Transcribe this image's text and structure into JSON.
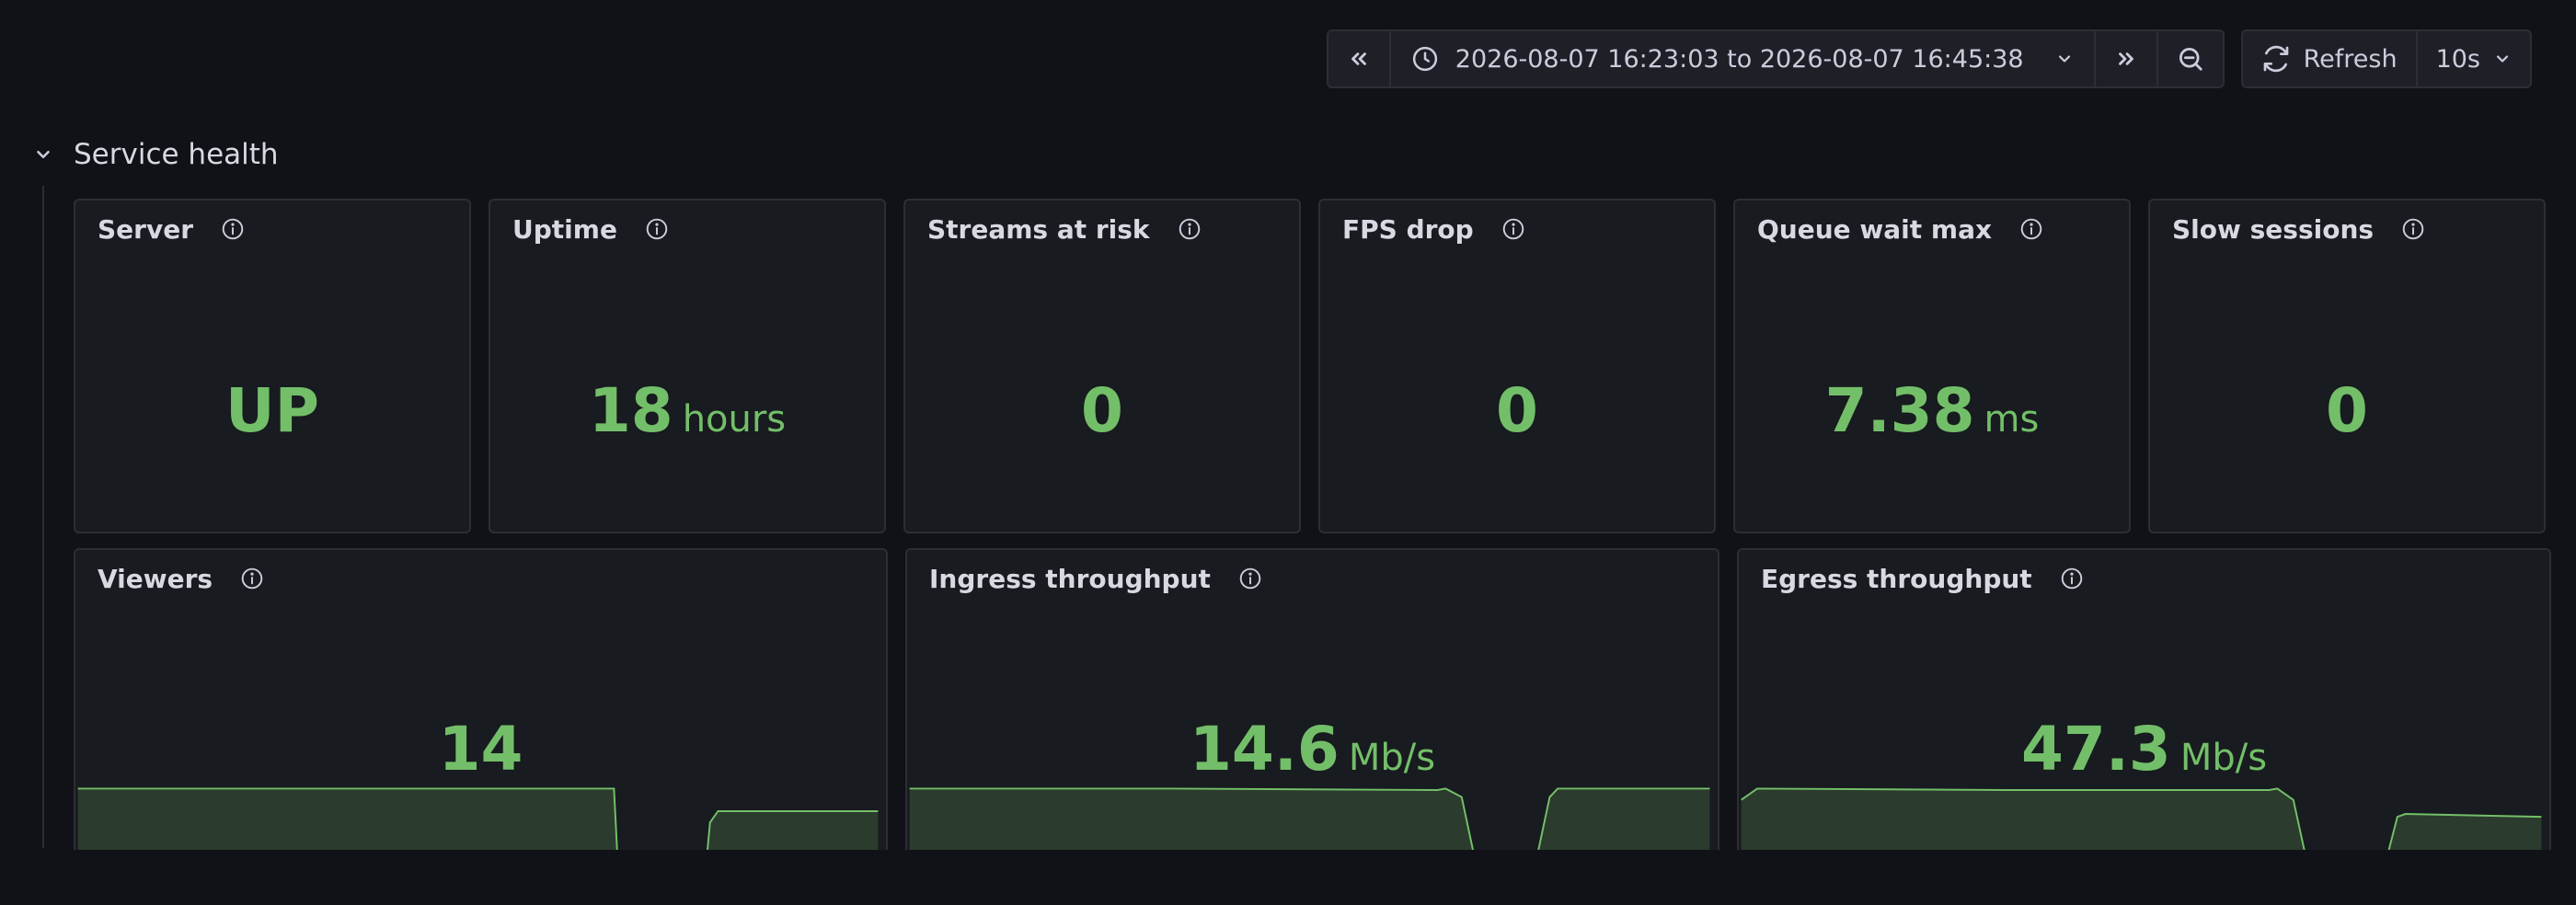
{
  "toolbar": {
    "time_range": "2026-08-07 16:23:03 to 2026-08-07 16:45:38",
    "refresh_label": "Refresh",
    "refresh_interval": "10s"
  },
  "row": {
    "title": "Service health"
  },
  "stats": [
    {
      "title": "Server",
      "value": "UP",
      "unit": ""
    },
    {
      "title": "Uptime",
      "value": "18",
      "unit": "hours"
    },
    {
      "title": "Streams at risk",
      "value": "0",
      "unit": ""
    },
    {
      "title": "FPS drop",
      "value": "0",
      "unit": ""
    },
    {
      "title": "Queue wait max",
      "value": "7.38",
      "unit": "ms"
    },
    {
      "title": "Slow sessions",
      "value": "0",
      "unit": ""
    }
  ],
  "timeseries": [
    {
      "title": "Viewers",
      "value": "14",
      "unit": "",
      "series": [
        [
          0,
          0.62
        ],
        [
          0.67,
          0.62
        ],
        [
          0.675,
          0.9
        ],
        [
          0.77,
          0.9
        ],
        [
          0.775,
          1.05
        ],
        [
          0.78,
          1.05
        ],
        [
          0.79,
          0.74
        ],
        [
          0.8,
          0.7
        ],
        [
          1.0,
          0.7
        ]
      ]
    },
    {
      "title": "Ingress throughput",
      "value": "14.6",
      "unit": "Mb/s",
      "series": [
        [
          0,
          0.62
        ],
        [
          0.33,
          0.62
        ],
        [
          0.66,
          0.625
        ],
        [
          0.67,
          0.62
        ],
        [
          0.69,
          0.65
        ],
        [
          0.72,
          1.05
        ],
        [
          0.77,
          1.05
        ],
        [
          0.8,
          0.65
        ],
        [
          0.81,
          0.62
        ],
        [
          1.0,
          0.62
        ]
      ]
    },
    {
      "title": "Egress throughput",
      "value": "47.3",
      "unit": "Mb/s",
      "series": [
        [
          0,
          0.66
        ],
        [
          0.02,
          0.62
        ],
        [
          0.33,
          0.625
        ],
        [
          0.66,
          0.625
        ],
        [
          0.67,
          0.62
        ],
        [
          0.69,
          0.66
        ],
        [
          0.72,
          1.05
        ],
        [
          0.79,
          1.05
        ],
        [
          0.82,
          0.72
        ],
        [
          0.83,
          0.71
        ],
        [
          1.0,
          0.72
        ]
      ]
    }
  ],
  "colors": {
    "value": "#73bf69",
    "fill": "#2b3b2d",
    "line": "#73bf69"
  }
}
